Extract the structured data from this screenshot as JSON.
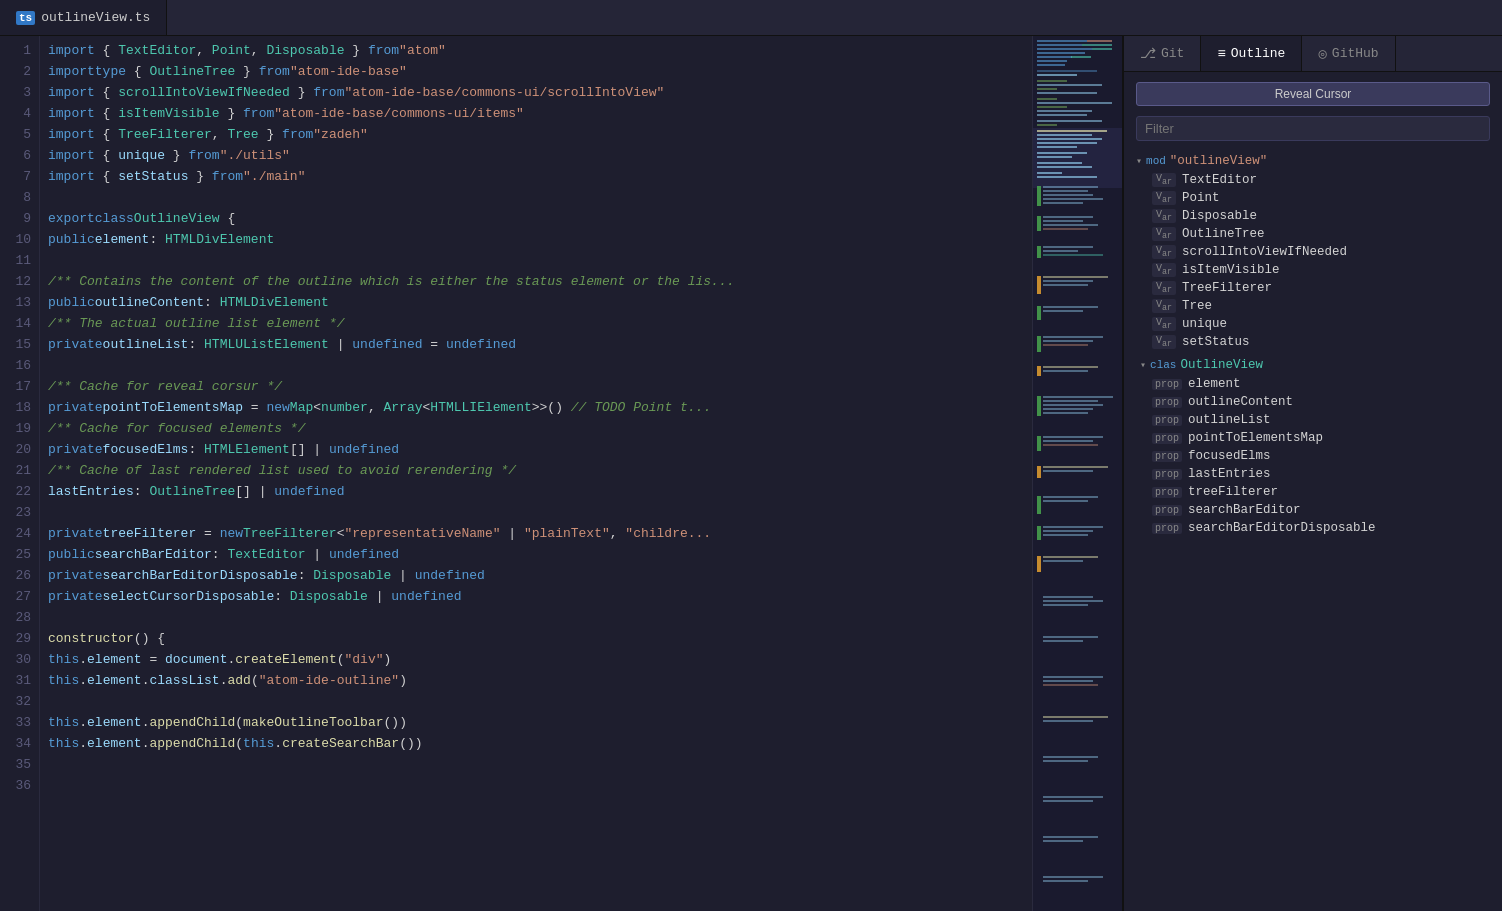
{
  "tab": {
    "icon": "TS",
    "filename": "outlineView.ts"
  },
  "panel_tabs": [
    {
      "id": "git",
      "icon": "⎇",
      "label": "Git"
    },
    {
      "id": "outline",
      "icon": "≡",
      "label": "Outline",
      "active": true
    },
    {
      "id": "github",
      "icon": "◎",
      "label": "GitHub"
    }
  ],
  "reveal_btn": "Reveal Cursor",
  "filter_placeholder": "Filter",
  "outline": {
    "mod": {
      "keyword": "mod",
      "name": "\"outlineView\"",
      "items": [
        {
          "kind": "Var",
          "name": "TextEditor"
        },
        {
          "kind": "Var",
          "name": "Point"
        },
        {
          "kind": "Var",
          "name": "Disposable"
        },
        {
          "kind": "Var",
          "name": "OutlineTree"
        },
        {
          "kind": "Var",
          "name": "scrollIntoViewIfNeeded"
        },
        {
          "kind": "Var",
          "name": "isItemVisible"
        },
        {
          "kind": "Var",
          "name": "TreeFilterer"
        },
        {
          "kind": "Var",
          "name": "Tree"
        },
        {
          "kind": "Var",
          "name": "unique"
        },
        {
          "kind": "Var",
          "name": "setStatus"
        }
      ]
    },
    "class": {
      "keyword": "clas",
      "name": "OutlineView",
      "props": [
        {
          "kind": "prop",
          "name": "element"
        },
        {
          "kind": "prop",
          "name": "outlineContent"
        },
        {
          "kind": "prop",
          "name": "outlineList"
        },
        {
          "kind": "prop",
          "name": "pointToElementsMap"
        },
        {
          "kind": "prop",
          "name": "focusedElms"
        },
        {
          "kind": "prop",
          "name": "lastEntries"
        },
        {
          "kind": "prop",
          "name": "treeFilterer"
        },
        {
          "kind": "prop",
          "name": "searchBarEditor"
        },
        {
          "kind": "prop",
          "name": "searchBarEditorDisposable"
        }
      ]
    }
  },
  "lines": [
    {
      "num": 1,
      "content": "import { TextEditor, Point, Disposable } from \"atom\""
    },
    {
      "num": 2,
      "content": "import type { OutlineTree } from \"atom-ide-base\""
    },
    {
      "num": 3,
      "content": "import { scrollIntoViewIfNeeded } from \"atom-ide-base/commons-ui/scrollIntoView\""
    },
    {
      "num": 4,
      "content": "import { isItemVisible } from \"atom-ide-base/commons-ui/items\""
    },
    {
      "num": 5,
      "content": "import { TreeFilterer, Tree } from \"zadeh\""
    },
    {
      "num": 6,
      "content": "import { unique } from \"./utils\""
    },
    {
      "num": 7,
      "content": "import { setStatus } from \"./main\""
    },
    {
      "num": 8,
      "content": ""
    },
    {
      "num": 9,
      "content": "export class OutlineView {"
    },
    {
      "num": 10,
      "content": "  public element: HTMLDivElement"
    },
    {
      "num": 11,
      "content": ""
    },
    {
      "num": 12,
      "content": "  /** Contains the content of the outline which is either the status element or the lis..."
    },
    {
      "num": 13,
      "content": "  public outlineContent: HTMLDivElement"
    },
    {
      "num": 14,
      "content": "  /** The actual outline list element */"
    },
    {
      "num": 15,
      "content": "  private outlineList: HTMLUListElement | undefined = undefined"
    },
    {
      "num": 16,
      "content": ""
    },
    {
      "num": 17,
      "content": "  /** Cache for reveal corsur */"
    },
    {
      "num": 18,
      "content": "  private pointToElementsMap = new Map<number, Array<HTMLLIElement>>() // TODO Point t..."
    },
    {
      "num": 19,
      "content": "  /** Cache for focused elements */"
    },
    {
      "num": 20,
      "content": "  private focusedElms: HTMLElement[] | undefined"
    },
    {
      "num": 21,
      "content": "  /** Cache of last rendered list used to avoid rerendering */"
    },
    {
      "num": 22,
      "content": "  lastEntries: OutlineTree[] | undefined"
    },
    {
      "num": 23,
      "content": ""
    },
    {
      "num": 24,
      "content": "  private treeFilterer = new TreeFilterer<\"representativeName\" | \"plainText\", \"childre..."
    },
    {
      "num": 25,
      "content": "  public searchBarEditor: TextEditor | undefined"
    },
    {
      "num": 26,
      "content": "  private searchBarEditorDisposable: Disposable | undefined"
    },
    {
      "num": 27,
      "content": "  private selectCursorDisposable: Disposable | undefined"
    },
    {
      "num": 28,
      "content": ""
    },
    {
      "num": 29,
      "content": "  constructor() {"
    },
    {
      "num": 30,
      "content": "    this.element = document.createElement(\"div\")"
    },
    {
      "num": 31,
      "content": "    this.element.classList.add(\"atom-ide-outline\")"
    },
    {
      "num": 32,
      "content": ""
    },
    {
      "num": 33,
      "content": "    this.element.appendChild(makeOutlineToolbar())"
    },
    {
      "num": 34,
      "content": "    this.element.appendChild(this.createSearchBar())"
    },
    {
      "num": 35,
      "content": ""
    },
    {
      "num": 36,
      "content": ""
    }
  ]
}
